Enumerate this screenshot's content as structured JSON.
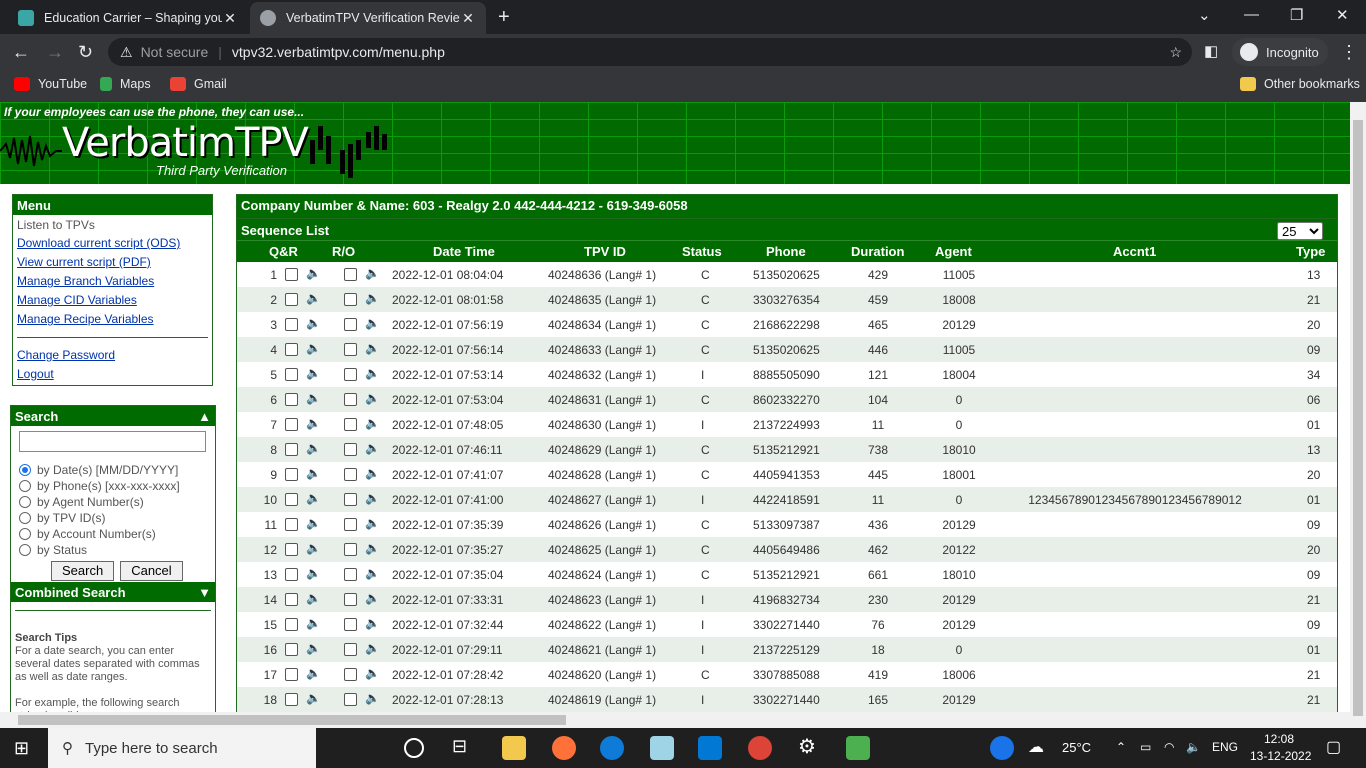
{
  "browser": {
    "tabs": [
      {
        "title": "Education Carrier – Shaping your",
        "active": false
      },
      {
        "title": "VerbatimTPV Verification Review",
        "active": true
      }
    ],
    "security_label": "Not secure",
    "url": "vtpv32.verbatimtpv.com/menu.php",
    "incognito_label": "Incognito",
    "bookmarks": [
      "YouTube",
      "Maps",
      "Gmail"
    ],
    "other_bookmarks": "Other bookmarks"
  },
  "banner": {
    "tagline": "If your employees can use the phone, they can use...",
    "logo": "VerbatimTPV",
    "subtitle": "Third Party Verification"
  },
  "menu": {
    "title": "Menu",
    "static_item": "Listen to TPVs",
    "links": [
      "Download current script (ODS)",
      "View current script (PDF)",
      "Manage Branch Variables",
      "Manage CID Variables",
      "Manage Recipe Variables"
    ],
    "account_links": [
      "Change Password",
      "Logout"
    ]
  },
  "search": {
    "title": "Search",
    "collapse_glyph": "▲",
    "options": [
      "by Date(s) [MM/DD/YYYY]",
      "by Phone(s) [xxx-xxx-xxxx]",
      "by Agent Number(s)",
      "by TPV ID(s)",
      "by Account Number(s)",
      "by Status"
    ],
    "selected_index": 0,
    "search_button": "Search",
    "cancel_button": "Cancel",
    "combined_title": "Combined Search",
    "combined_glyph": "▼",
    "tips_title": "Search Tips",
    "tips_text": "For a date search, you can enter several dates separated with commas as well as date ranges.",
    "tips_example": "For example, the following search string is valid:"
  },
  "main": {
    "company_line": "Company Number & Name: 603 - Realgy 2.0 442-444-4212 - 619-349-6058",
    "sequence_title": "Sequence List",
    "page_size": "25",
    "columns": [
      "Q&R",
      "R/O",
      "Date Time",
      "TPV ID",
      "Status",
      "Phone",
      "Duration",
      "Agent",
      "Accnt1",
      "Type"
    ],
    "rows": [
      {
        "n": "1",
        "dt": "2022-12-01 08:04:04",
        "tpv": "40248636 (Lang# 1)",
        "st": "C",
        "ph": "5135020625",
        "dur": "429",
        "agent": "11005",
        "acct": "",
        "type": "13"
      },
      {
        "n": "2",
        "dt": "2022-12-01 08:01:58",
        "tpv": "40248635 (Lang# 1)",
        "st": "C",
        "ph": "3303276354",
        "dur": "459",
        "agent": "18008",
        "acct": "",
        "type": "21"
      },
      {
        "n": "3",
        "dt": "2022-12-01 07:56:19",
        "tpv": "40248634 (Lang# 1)",
        "st": "C",
        "ph": "2168622298",
        "dur": "465",
        "agent": "20129",
        "acct": "",
        "type": "20"
      },
      {
        "n": "4",
        "dt": "2022-12-01 07:56:14",
        "tpv": "40248633 (Lang# 1)",
        "st": "C",
        "ph": "5135020625",
        "dur": "446",
        "agent": "11005",
        "acct": "",
        "type": "09"
      },
      {
        "n": "5",
        "dt": "2022-12-01 07:53:14",
        "tpv": "40248632 (Lang# 1)",
        "st": "I",
        "ph": "8885505090",
        "dur": "121",
        "agent": "18004",
        "acct": "",
        "type": "34"
      },
      {
        "n": "6",
        "dt": "2022-12-01 07:53:04",
        "tpv": "40248631 (Lang# 1)",
        "st": "C",
        "ph": "8602332270",
        "dur": "104",
        "agent": "0",
        "acct": "",
        "type": "06"
      },
      {
        "n": "7",
        "dt": "2022-12-01 07:48:05",
        "tpv": "40248630 (Lang# 1)",
        "st": "I",
        "ph": "2137224993",
        "dur": "11",
        "agent": "0",
        "acct": "",
        "type": "01"
      },
      {
        "n": "8",
        "dt": "2022-12-01 07:46:11",
        "tpv": "40248629 (Lang# 1)",
        "st": "C",
        "ph": "5135212921",
        "dur": "738",
        "agent": "18010",
        "acct": "",
        "type": "13"
      },
      {
        "n": "9",
        "dt": "2022-12-01 07:41:07",
        "tpv": "40248628 (Lang# 1)",
        "st": "C",
        "ph": "4405941353",
        "dur": "445",
        "agent": "18001",
        "acct": "",
        "type": "20"
      },
      {
        "n": "10",
        "dt": "2022-12-01 07:41:00",
        "tpv": "40248627 (Lang# 1)",
        "st": "I",
        "ph": "4422418591",
        "dur": "11",
        "agent": "0",
        "acct": "12345678901234567890123456789012",
        "type": "01"
      },
      {
        "n": "11",
        "dt": "2022-12-01 07:35:39",
        "tpv": "40248626 (Lang# 1)",
        "st": "C",
        "ph": "5133097387",
        "dur": "436",
        "agent": "20129",
        "acct": "",
        "type": "09"
      },
      {
        "n": "12",
        "dt": "2022-12-01 07:35:27",
        "tpv": "40248625 (Lang# 1)",
        "st": "C",
        "ph": "4405649486",
        "dur": "462",
        "agent": "20122",
        "acct": "",
        "type": "20"
      },
      {
        "n": "13",
        "dt": "2022-12-01 07:35:04",
        "tpv": "40248624 (Lang# 1)",
        "st": "C",
        "ph": "5135212921",
        "dur": "661",
        "agent": "18010",
        "acct": "",
        "type": "09"
      },
      {
        "n": "14",
        "dt": "2022-12-01 07:33:31",
        "tpv": "40248623 (Lang# 1)",
        "st": "I",
        "ph": "4196832734",
        "dur": "230",
        "agent": "20129",
        "acct": "",
        "type": "21"
      },
      {
        "n": "15",
        "dt": "2022-12-01 07:32:44",
        "tpv": "40248622 (Lang# 1)",
        "st": "I",
        "ph": "3302271440",
        "dur": "76",
        "agent": "20129",
        "acct": "",
        "type": "09"
      },
      {
        "n": "16",
        "dt": "2022-12-01 07:29:11",
        "tpv": "40248621 (Lang# 1)",
        "st": "I",
        "ph": "2137225129",
        "dur": "18",
        "agent": "0",
        "acct": "",
        "type": "01"
      },
      {
        "n": "17",
        "dt": "2022-12-01 07:28:42",
        "tpv": "40248620 (Lang# 1)",
        "st": "C",
        "ph": "3307885088",
        "dur": "419",
        "agent": "18006",
        "acct": "",
        "type": "21"
      },
      {
        "n": "18",
        "dt": "2022-12-01 07:28:13",
        "tpv": "40248619 (Lang# 1)",
        "st": "I",
        "ph": "3302271440",
        "dur": "165",
        "agent": "20129",
        "acct": "",
        "type": "21"
      }
    ]
  },
  "taskbar": {
    "search_placeholder": "Type here to search",
    "temperature": "25°C",
    "language": "ENG",
    "time": "12:08",
    "date": "13-12-2022"
  },
  "colors": {
    "brand_green": "#016b01",
    "link_blue": "#0033aa",
    "row_alt": "#e8efe8"
  }
}
